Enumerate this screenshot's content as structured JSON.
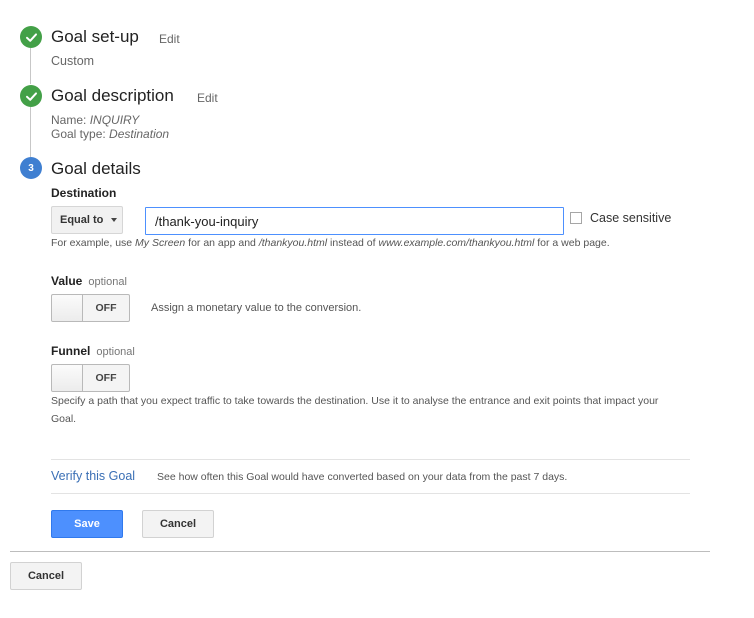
{
  "steps": [
    {
      "title": "Goal set-up",
      "edit_label": "Edit",
      "detail": "Custom",
      "icon": "check-icon",
      "status_color": "#43a047"
    },
    {
      "title": "Goal description",
      "edit_label": "Edit",
      "name_label": "Name:",
      "name_value": "INQUIRY",
      "type_label": "Goal type:",
      "type_value": "Destination",
      "icon": "check-icon",
      "status_color": "#43a047"
    },
    {
      "title": "Goal details",
      "number": "3",
      "status_color": "#3f7fd1"
    }
  ],
  "destination": {
    "label": "Destination",
    "match_type": "Equal to",
    "value": "/thank-you-inquiry",
    "case_sensitive_label": "Case sensitive",
    "help": {
      "prefix": "For example, use",
      "app_example": "My Screen",
      "mid1": "for an app and",
      "path_example": "/thankyou.html",
      "mid2": "instead of",
      "url_example": "www.example.com/thankyou.html",
      "suffix": "for a web page."
    }
  },
  "value_section": {
    "label": "Value",
    "optional": "optional",
    "toggle_state": "OFF",
    "description": "Assign a monetary value to the conversion."
  },
  "funnel_section": {
    "label": "Funnel",
    "optional": "optional",
    "toggle_state": "OFF",
    "description_line1": "Specify a path that you expect traffic to take towards the destination. Use it to analyse the entrance and exit points that impact your",
    "description_line2": "Goal."
  },
  "verify": {
    "link": "Verify this Goal",
    "description": "See how often this Goal would have converted based on your data from the past 7 days."
  },
  "actions": {
    "save_label": "Save",
    "cancel_label": "Cancel",
    "outer_cancel_label": "Cancel"
  },
  "colors": {
    "primary_button": "#4d90fe",
    "link": "#3a6fb5",
    "input_focus_border": "#4d90fe"
  }
}
